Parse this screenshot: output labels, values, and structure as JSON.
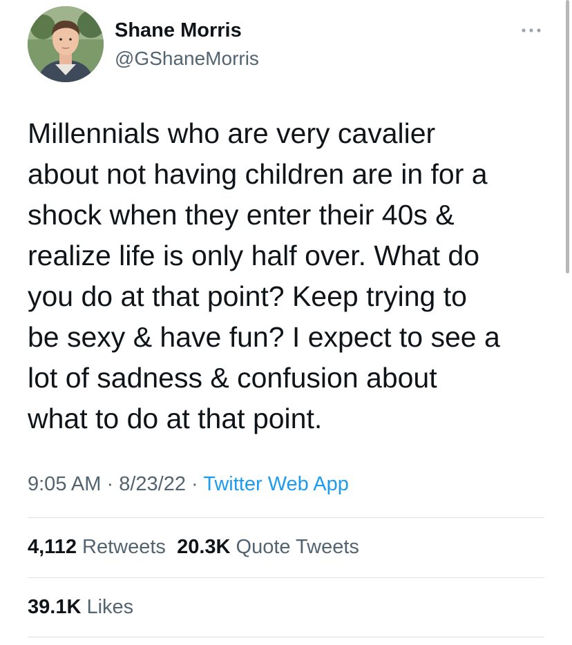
{
  "author": {
    "display_name": "Shane Morris",
    "handle": "@GShaneMorris"
  },
  "tweet": {
    "text_lines": [
      "Millennials who are very cavalier",
      "about not having children are in for a",
      "shock when they enter their 40s &",
      "realize life is only half over. What do",
      "you do at that point? Keep trying to",
      "be sexy & have fun? I expect to see a",
      "lot of sadness & confusion about",
      "what to do at that point."
    ],
    "time": "9:05 AM",
    "date": "8/23/22",
    "separator": "·",
    "source": "Twitter Web App"
  },
  "stats": {
    "retweets_count": "4,112",
    "retweets_label": "Retweets",
    "quotes_count": "20.3K",
    "quotes_label": "Quote Tweets",
    "likes_count": "39.1K",
    "likes_label": "Likes"
  },
  "icons": {
    "more": "more-horizontal-icon"
  },
  "colors": {
    "text": "#0f1419",
    "secondary": "#536471",
    "link": "#1d9bf0",
    "divider": "#dfe3e6"
  }
}
